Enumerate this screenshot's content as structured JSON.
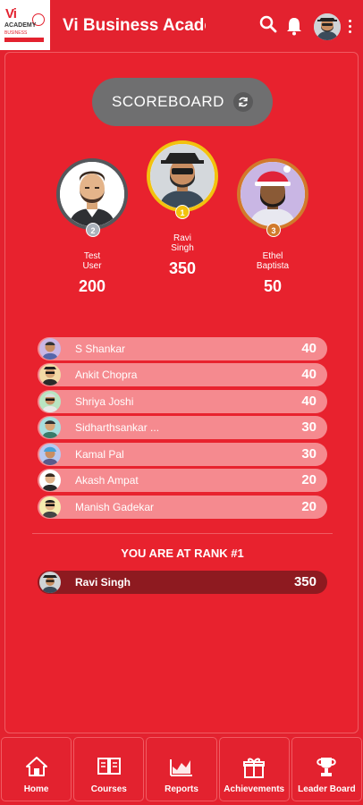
{
  "header": {
    "title": "Vi Business Acade...",
    "logo": {
      "brand": "Vi",
      "academy": "ACADEMY",
      "sub": "BUSINESS"
    }
  },
  "scoreboard": {
    "label": "SCOREBOARD"
  },
  "podium": [
    {
      "rank": 2,
      "name_line1": "Test",
      "name_line2": "User",
      "score": "200",
      "medal": "2",
      "ring_color": "#54585c"
    },
    {
      "rank": 1,
      "name_line1": "Ravi",
      "name_line2": "Singh",
      "score": "350",
      "medal": "1",
      "ring_color": "#f2c20e"
    },
    {
      "rank": 3,
      "name_line1": "Ethel",
      "name_line2": "Baptista",
      "score": "50",
      "medal": "3",
      "ring_color": "#d17a2c"
    }
  ],
  "leaderboard": [
    {
      "name": "S Shankar",
      "score": "40"
    },
    {
      "name": "Ankit Chopra",
      "score": "40"
    },
    {
      "name": "Shriya Joshi",
      "score": "40"
    },
    {
      "name": "Sidharthsankar ...",
      "score": "30"
    },
    {
      "name": "Kamal Pal",
      "score": "30"
    },
    {
      "name": "Akash Ampat",
      "score": "20"
    },
    {
      "name": "Manish Gadekar",
      "score": "20"
    }
  ],
  "my_rank": {
    "label": "YOU ARE AT RANK #1",
    "name": "Ravi Singh",
    "score": "350"
  },
  "bottom_nav": [
    {
      "label": "Home",
      "icon": "home-icon"
    },
    {
      "label": "Courses",
      "icon": "book-icon"
    },
    {
      "label": "Reports",
      "icon": "chart-icon"
    },
    {
      "label": "Achievements",
      "icon": "gift-icon"
    },
    {
      "label": "Leader Board",
      "icon": "trophy-icon"
    }
  ],
  "colors": {
    "brand_red": "#e3222f",
    "row_pink": "#f58a8f",
    "my_row": "#8e1a20",
    "scoreboard_gray": "#6f6f70"
  }
}
